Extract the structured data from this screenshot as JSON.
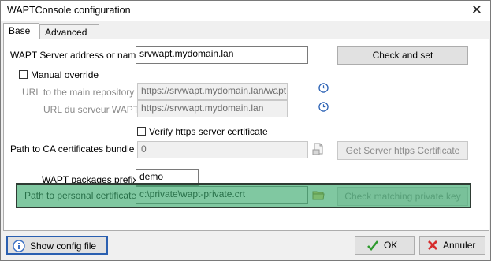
{
  "window": {
    "title": "WAPTConsole configuration"
  },
  "tabs": [
    {
      "label": "Base",
      "active": true
    },
    {
      "label": "Advanced",
      "active": false
    }
  ],
  "form": {
    "server_address_label": "WAPT Server address or name",
    "server_address_value": "srvwapt.mydomain.lan",
    "check_and_set_label": "Check and set",
    "manual_override_label": "Manual override",
    "repo_url_label": "URL to the main repository",
    "repo_url_value": "https://srvwapt.mydomain.lan/wapt",
    "server_url_label": "URL du serveur WAPT",
    "server_url_value": "https://srvwapt.mydomain.lan",
    "verify_https_label": "Verify https server certificate",
    "ca_bundle_label": "Path to CA certificates bundle",
    "ca_bundle_value": "0",
    "get_server_cert_label": "Get Server https Certificate",
    "packages_prefix_label": "WAPT packages prefix",
    "packages_prefix_value": "demo",
    "personal_cert_label": "Path to personal certificate",
    "personal_cert_value": "c:\\private\\wapt-private.crt",
    "check_private_key_label": "Check matching private key"
  },
  "footer": {
    "show_config_label": "Show config file",
    "ok_label": "OK",
    "cancel_label": "Annuler"
  },
  "colors": {
    "highlight": "#3caa6e",
    "ok_icon": "#2e9a2e",
    "cancel_icon": "#d62b2b",
    "info_icon": "#3a6fc4"
  }
}
